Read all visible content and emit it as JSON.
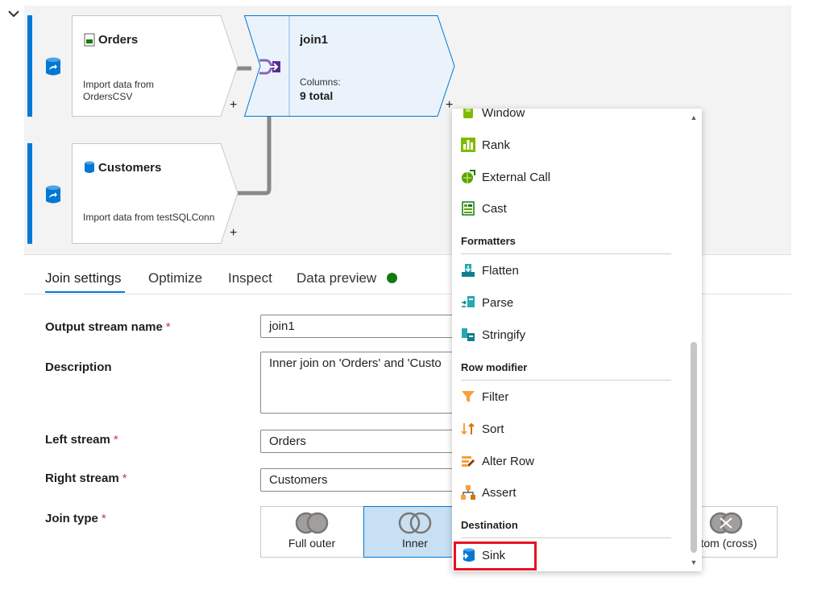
{
  "canvas": {
    "orders": {
      "title": "Orders",
      "subtitle_line1": "Import data from",
      "subtitle_line2": "OrdersCSV"
    },
    "customers": {
      "title": "Customers",
      "subtitle": "Import data from testSQLConn"
    },
    "join": {
      "title": "join1",
      "columns_label": "Columns:",
      "columns_value": "9 total"
    },
    "plus": "+"
  },
  "tabs": [
    {
      "label": "Join settings"
    },
    {
      "label": "Optimize"
    },
    {
      "label": "Inspect"
    },
    {
      "label": "Data preview"
    }
  ],
  "form": {
    "required_mark": "*",
    "output_label": "Output stream name",
    "output_value": "join1",
    "description_label": "Description",
    "description_value": "Inner join on 'Orders' and 'Custo",
    "left_label": "Left stream",
    "left_value": "Orders",
    "right_label": "Right stream",
    "right_value": "Customers",
    "jointype_label": "Join type",
    "join_options": [
      {
        "label": "Full outer"
      },
      {
        "label": "Inner"
      },
      {
        "label": "stom (cross)"
      }
    ]
  },
  "menu": {
    "items_top": [
      {
        "label": "Window",
        "icon": "window-icon"
      },
      {
        "label": "Rank",
        "icon": "rank-icon"
      },
      {
        "label": "External Call",
        "icon": "external-call-icon"
      },
      {
        "label": "Cast",
        "icon": "cast-icon"
      }
    ],
    "formatters_header": "Formatters",
    "formatters": [
      {
        "label": "Flatten",
        "icon": "flatten-icon"
      },
      {
        "label": "Parse",
        "icon": "parse-icon"
      },
      {
        "label": "Stringify",
        "icon": "stringify-icon"
      }
    ],
    "rowmod_header": "Row modifier",
    "row_modifiers": [
      {
        "label": "Filter",
        "icon": "filter-icon"
      },
      {
        "label": "Sort",
        "icon": "sort-icon"
      },
      {
        "label": "Alter Row",
        "icon": "alter-row-icon"
      },
      {
        "label": "Assert",
        "icon": "assert-icon"
      }
    ],
    "destination_header": "Destination",
    "destination": [
      {
        "label": "Sink",
        "icon": "sink-icon"
      }
    ]
  },
  "colors": {
    "accent": "#0078d4",
    "status_ok": "#107c10",
    "highlight": "#e81123"
  }
}
